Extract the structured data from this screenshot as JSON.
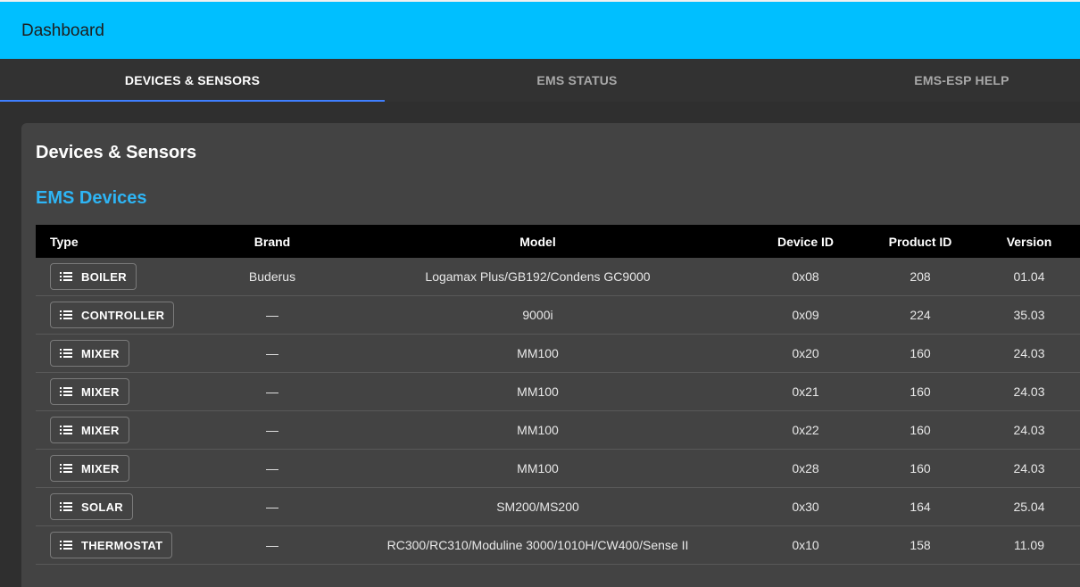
{
  "appbar": {
    "title": "Dashboard"
  },
  "tabs": [
    {
      "label": "DEVICES & SENSORS",
      "active": true
    },
    {
      "label": "EMS STATUS",
      "active": false
    },
    {
      "label": "EMS-ESP HELP",
      "active": false
    }
  ],
  "card": {
    "title": "Devices & Sensors",
    "section_title": "EMS Devices"
  },
  "table": {
    "columns": [
      "Type",
      "Brand",
      "Model",
      "Device ID",
      "Product ID",
      "Version"
    ],
    "rows": [
      {
        "type": "BOILER",
        "brand": "Buderus",
        "model": "Logamax Plus/GB192/Condens GC9000",
        "device_id": "0x08",
        "product_id": "208",
        "version": "01.04"
      },
      {
        "type": "CONTROLLER",
        "brand": "—",
        "model": "9000i",
        "device_id": "0x09",
        "product_id": "224",
        "version": "35.03"
      },
      {
        "type": "MIXER",
        "brand": "—",
        "model": "MM100",
        "device_id": "0x20",
        "product_id": "160",
        "version": "24.03"
      },
      {
        "type": "MIXER",
        "brand": "—",
        "model": "MM100",
        "device_id": "0x21",
        "product_id": "160",
        "version": "24.03"
      },
      {
        "type": "MIXER",
        "brand": "—",
        "model": "MM100",
        "device_id": "0x22",
        "product_id": "160",
        "version": "24.03"
      },
      {
        "type": "MIXER",
        "brand": "—",
        "model": "MM100",
        "device_id": "0x28",
        "product_id": "160",
        "version": "24.03"
      },
      {
        "type": "SOLAR",
        "brand": "—",
        "model": "SM200/MS200",
        "device_id": "0x30",
        "product_id": "164",
        "version": "25.04"
      },
      {
        "type": "THERMOSTAT",
        "brand": "—",
        "model": "RC300/RC310/Moduline 3000/1010H/CW400/Sense II",
        "device_id": "0x10",
        "product_id": "158",
        "version": "11.09"
      }
    ]
  },
  "icons": {
    "row_button_icon": "list-icon"
  },
  "colors": {
    "appbar": "#00bfff",
    "tab_indicator": "#3f7fff",
    "section_title": "#2eb5f5"
  }
}
